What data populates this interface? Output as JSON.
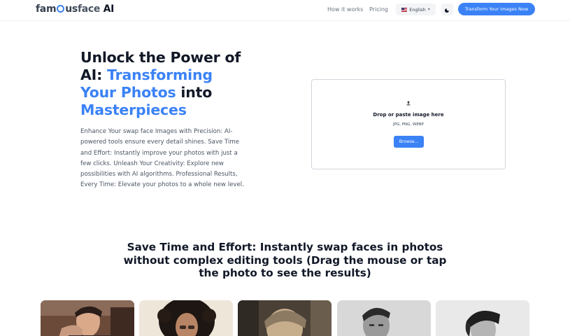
{
  "header": {
    "logo": {
      "part1": "fam",
      "part2": "us",
      "part3": "face",
      "part4": " AI"
    },
    "nav": [
      {
        "label": "How it works"
      },
      {
        "label": "Pricing"
      }
    ],
    "language": {
      "label": "English"
    },
    "cta_label": "Transform Your Images Now"
  },
  "hero": {
    "title_line1": "Unlock the Power of",
    "title_ai": "AI:",
    "title_blue1": "Transforming",
    "title_blue2": "Your Photos",
    "title_into": "into",
    "title_blue3": "Masterpieces",
    "description": "Enhance Your swap face Images with Precision: AI-powered tools ensure every detail shines. Save Time and Effort: Instantly improve your photos with just a few clicks. Unleash Your Creativity: Explore new possibilities with AI algorithms. Professional Results, Every Time: Elevate your photos to a whole new level."
  },
  "upload": {
    "icon": "upload-icon",
    "main_text": "Drop or paste image here",
    "formats": "JPG, PNG, WEBP",
    "browse_label": "Browse..."
  },
  "section": {
    "title": "Save Time and Effort: Instantly swap faces in photos without complex editing tools (Drag the mouse or tap the photo to see the results)"
  },
  "colors": {
    "accent": "#3b82f6",
    "text": "#111827",
    "muted": "#6b7280"
  }
}
